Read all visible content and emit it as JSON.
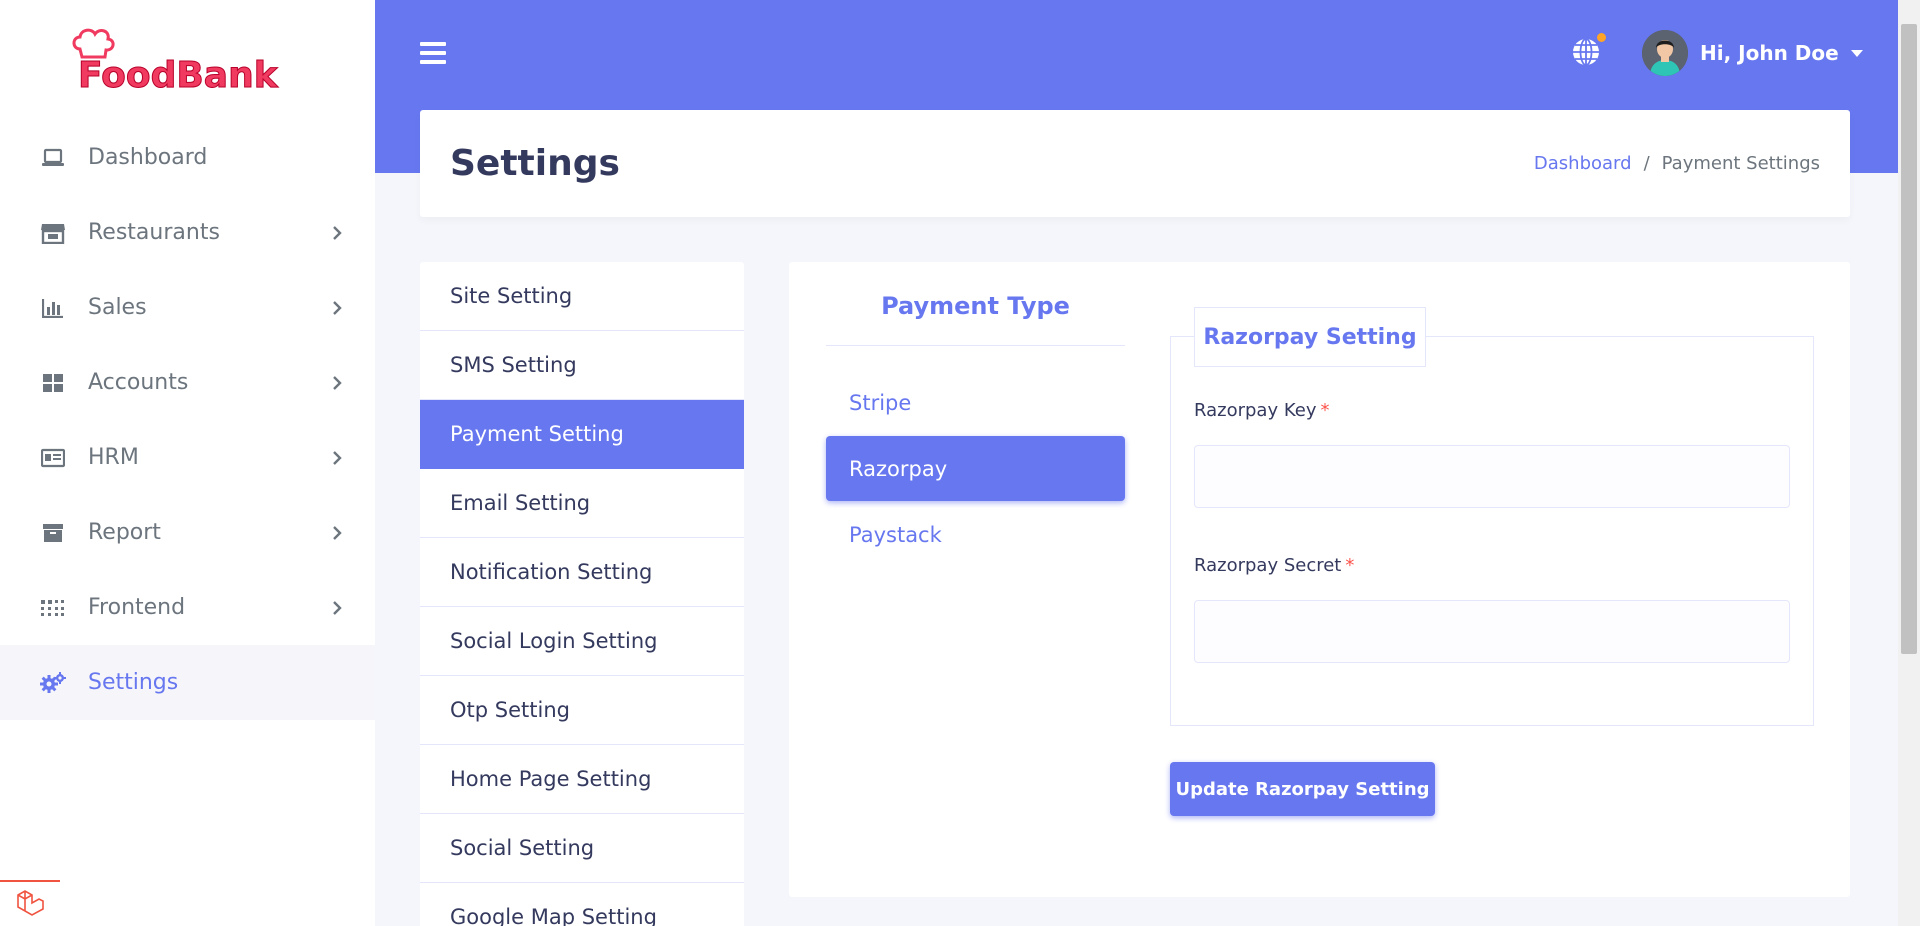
{
  "brand": {
    "logo_text": "FoodBank"
  },
  "sidebar": {
    "items": [
      {
        "label": "Dashboard",
        "icon": "laptop-icon",
        "has_submenu": false
      },
      {
        "label": "Restaurants",
        "icon": "store-icon",
        "has_submenu": true
      },
      {
        "label": "Sales",
        "icon": "bar-chart-icon",
        "has_submenu": true
      },
      {
        "label": "Accounts",
        "icon": "grid-icon",
        "has_submenu": true
      },
      {
        "label": "HRM",
        "icon": "id-card-icon",
        "has_submenu": true
      },
      {
        "label": "Report",
        "icon": "archive-icon",
        "has_submenu": true
      },
      {
        "label": "Frontend",
        "icon": "dots-grid-icon",
        "has_submenu": true
      },
      {
        "label": "Settings",
        "icon": "cogs-icon",
        "has_submenu": false,
        "active": true
      }
    ]
  },
  "header": {
    "user_greeting": "Hi, John Doe",
    "language_icon": "globe-icon",
    "notification_dot_color": "#ffa426"
  },
  "page": {
    "title": "Settings",
    "breadcrumb": {
      "home": "Dashboard",
      "separator": "/",
      "current": "Payment Settings"
    }
  },
  "settings_menu": {
    "items": [
      "Site Setting",
      "SMS Setting",
      "Payment Setting",
      "Email Setting",
      "Notification Setting",
      "Social Login Setting",
      "Otp Setting",
      "Home Page Setting",
      "Social Setting",
      "Google Map Setting"
    ],
    "active_index": 2
  },
  "payment": {
    "type_title": "Payment Type",
    "types": [
      "Stripe",
      "Razorpay",
      "Paystack"
    ],
    "active_type": "Razorpay",
    "form": {
      "legend": "Razorpay Setting",
      "key_label": "Razorpay Key",
      "key_value": "",
      "secret_label": "Razorpay Secret",
      "secret_value": "",
      "required_mark": "*",
      "submit_label": "Update Razorpay Setting"
    }
  },
  "colors": {
    "primary": "#6777ef",
    "brand_red": "#f03a5f",
    "required": "#fc544b",
    "text": "#34395e",
    "muted": "#6c757d"
  }
}
